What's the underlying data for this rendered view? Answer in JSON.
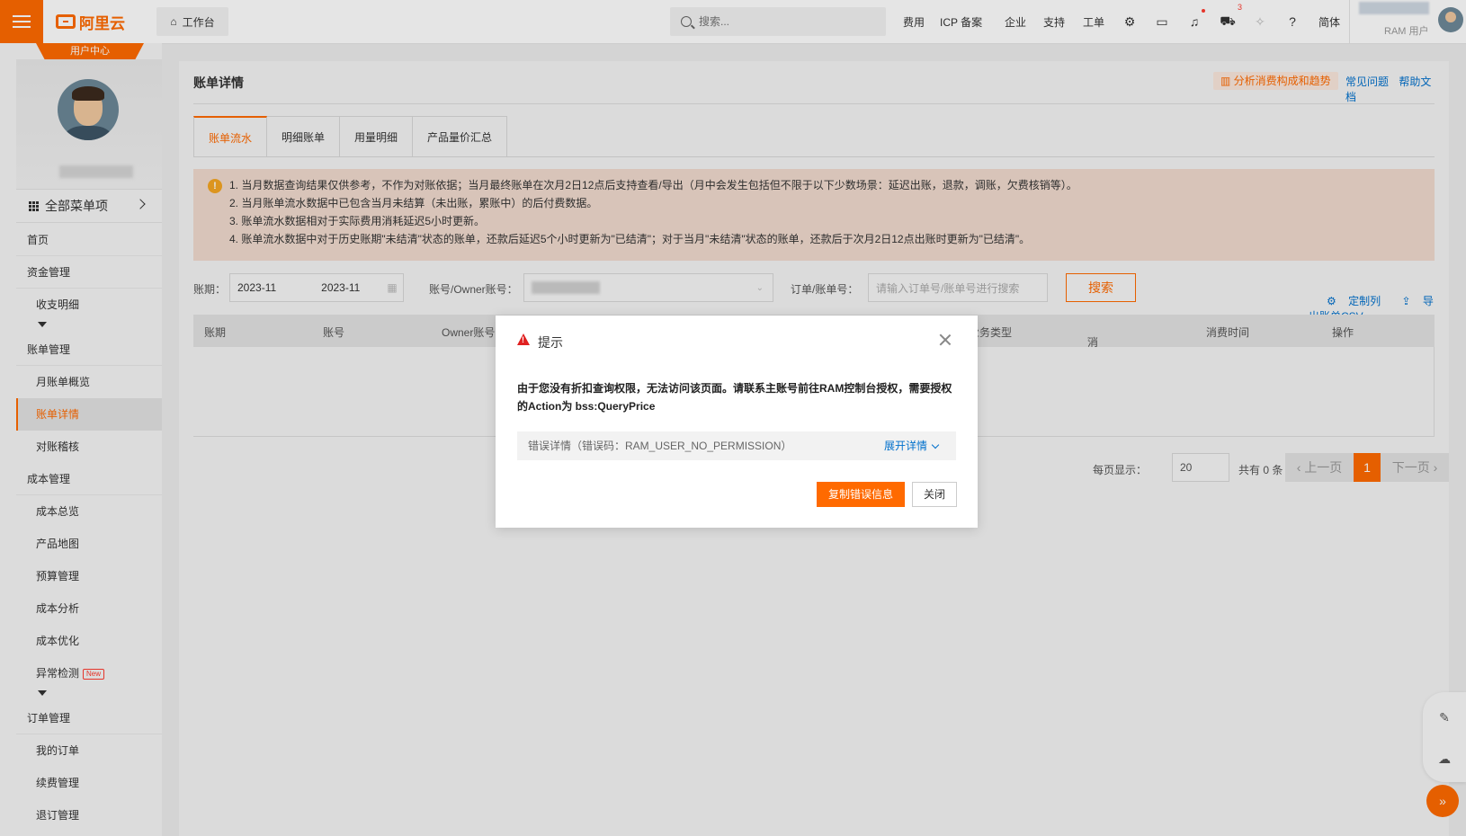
{
  "topbar": {
    "logo": "阿里云",
    "workbench": "工作台",
    "search_placeholder": "搜索...",
    "links": [
      "费用",
      "ICP 备案",
      "企业",
      "支持",
      "工单"
    ],
    "cart_badge": "3",
    "lang": "简体",
    "user_label": "RAM 用户"
  },
  "sidebar": {
    "usercenter": "用户中心",
    "all_menu": "全部菜单项",
    "home": "首页",
    "groups": {
      "funds": "资金管理",
      "funds_detail": "收支明细",
      "bills": "账单管理",
      "bills_monthly": "月账单概览",
      "bills_detail": "账单详情",
      "bills_check": "对账稽核",
      "cost": "成本管理",
      "cost_overview": "成本总览",
      "cost_map": "产品地图",
      "cost_budget": "预算管理",
      "cost_analysis": "成本分析",
      "cost_optimize": "成本优化",
      "cost_anomaly": "异常检测",
      "new_tag": "New",
      "orders": "订单管理",
      "orders_mine": "我的订单",
      "orders_renew": "续费管理",
      "orders_refund": "退订管理"
    }
  },
  "main": {
    "title": "账单详情",
    "analysis": "分析消费构成和趋势",
    "faq": "常见问题",
    "docs": "帮助文档",
    "tabs": [
      "账单流水",
      "明细账单",
      "用量明细",
      "产品量价汇总"
    ],
    "notice": [
      "1. 当月数据查询结果仅供参考，不作为对账依据；当月最终账单在次月2日12点后支持查看/导出（月中会发生包括但不限于以下少数场景：延迟出账，退款，调账，欠费核销等）。",
      "2. 当月账单流水数据中已包含当月未结算（未出账，累账中）的后付费数据。",
      "3. 账单流水数据相对于实际费用消耗延迟5小时更新。",
      "4. 账单流水数据中对于历史账期\"未结清\"状态的账单，还款后延迟5个小时更新为\"已结清\"；对于当月\"未结清\"状态的账单，还款后于次月2日12点出账时更新为\"已结清\"。"
    ],
    "filters": {
      "period_label": "账期：",
      "period_start": "2023-11",
      "period_end": "2023-11",
      "account_label": "账号/Owner账号：",
      "order_label": "订单/账单号：",
      "order_placeholder": "请输入订单号/账单号进行搜索",
      "search": "搜索",
      "custom_cols": "定制列",
      "export": "导出账单CSV"
    },
    "table_headers": [
      "账期",
      "账号",
      "Owner账号",
      "业务类型",
      "消费类型",
      "消费时间",
      "操作"
    ],
    "pager": {
      "per_page_label": "每页显示：",
      "per_page": "20",
      "total": "共有 0 条",
      "prev": "上一页",
      "current": "1",
      "next": "下一页"
    }
  },
  "modal": {
    "title": "提示",
    "message": "由于您没有折扣查询权限，无法访问该页面。请联系主账号前往RAM控制台授权，需要授权的Action为 bss:QueryPrice",
    "detail": "错误详情（错误码：RAM_USER_NO_PERMISSION）",
    "expand": "展开详情",
    "copy": "复制错误信息",
    "close": "关闭"
  },
  "colors": {
    "accent": "#ff6a00",
    "link": "#0070cc"
  }
}
